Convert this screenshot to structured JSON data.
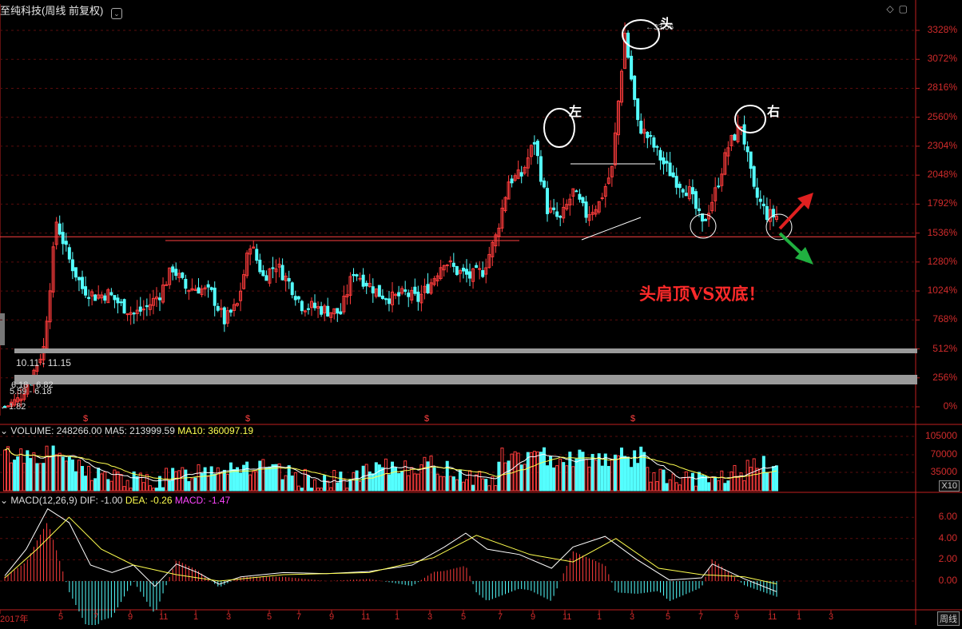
{
  "header": {
    "title": "至纯科技(周线 前复权)",
    "toolbar_icons": [
      "chevron-icon",
      "diamond-icon",
      "square-icon"
    ]
  },
  "price_axis_labels": [
    "3328%",
    "3072%",
    "2816%",
    "2560%",
    "2304%",
    "2048%",
    "1792%",
    "1536%",
    "1280%",
    "1024%",
    "768%",
    "512%",
    "256%",
    "0%"
  ],
  "annotations": {
    "head_label": "头",
    "left_shoulder_label": "左",
    "right_shoulder_label": "右",
    "caption": "头肩顶VS双底！",
    "peak_value": "33.56",
    "low_value": "1.82"
  },
  "period_bars": {
    "bar1_label": "10.11 - 11.15",
    "bar2_label_a": "6.18 - 6.82",
    "bar2_label_b": "5.59 - 6.18"
  },
  "volume": {
    "legend_label": "VOLUME: 248266.00",
    "ma5_label": "MA5: 213999.59",
    "ma10_label": "MA10: 360097.19",
    "axis_labels": [
      "105000",
      "70000",
      "35000"
    ],
    "unit": "X10"
  },
  "macd": {
    "legend_label": "MACD(12,26,9)",
    "dif_label": "DIF: -1.00",
    "dea_label": "DEA: -0.26",
    "macd_label": "MACD: -1.47",
    "axis_labels": [
      "6.00",
      "4.00",
      "2.00",
      "0.00"
    ]
  },
  "x_axis_labels": [
    "2017年",
    "5",
    "7",
    "9",
    "11",
    "1",
    "3",
    "5",
    "7",
    "9",
    "11",
    "1",
    "3",
    "5",
    "7",
    "9",
    "11",
    "1",
    "3",
    "5",
    "7",
    "9",
    "11",
    "1",
    "3"
  ],
  "corner_label": "周线",
  "colors": {
    "up": "#ff3c3c",
    "down": "#54ffff",
    "ma5": "#ffffff",
    "ma10": "#ffff4f",
    "axis": "#c02020",
    "arrow_up": "#e02020",
    "arrow_down": "#20b040"
  },
  "chart_data": {
    "type": "candlestick",
    "title": "至纯科技(周线 前复权)",
    "ylabel": "",
    "ylim": [
      0,
      3328
    ],
    "y_unit": "%",
    "close_path_pct": [
      [
        0,
        0
      ],
      [
        2,
        60
      ],
      [
        4,
        250
      ],
      [
        6,
        520
      ],
      [
        8,
        1640
      ],
      [
        10,
        1300
      ],
      [
        12,
        1050
      ],
      [
        14,
        980
      ],
      [
        16,
        1000
      ],
      [
        18,
        900
      ],
      [
        20,
        820
      ],
      [
        22,
        880
      ],
      [
        24,
        1000
      ],
      [
        26,
        1230
      ],
      [
        28,
        1050
      ],
      [
        30,
        1050
      ],
      [
        32,
        1000
      ],
      [
        34,
        760
      ],
      [
        36,
        900
      ],
      [
        38,
        1450
      ],
      [
        40,
        1150
      ],
      [
        42,
        1260
      ],
      [
        44,
        1100
      ],
      [
        46,
        900
      ],
      [
        48,
        880
      ],
      [
        50,
        850
      ],
      [
        52,
        830
      ],
      [
        54,
        1200
      ],
      [
        56,
        1100
      ],
      [
        58,
        1000
      ],
      [
        60,
        960
      ],
      [
        62,
        1000
      ],
      [
        64,
        950
      ],
      [
        66,
        1100
      ],
      [
        68,
        1300
      ],
      [
        70,
        1200
      ],
      [
        72,
        1150
      ],
      [
        74,
        1200
      ],
      [
        76,
        1500
      ],
      [
        78,
        2000
      ],
      [
        80,
        2050
      ],
      [
        82,
        2350
      ],
      [
        84,
        1750
      ],
      [
        86,
        1650
      ],
      [
        88,
        1900
      ],
      [
        90,
        1700
      ],
      [
        92,
        1800
      ],
      [
        94,
        2100
      ],
      [
        96,
        3300
      ],
      [
        98,
        2500
      ],
      [
        100,
        2350
      ],
      [
        102,
        2150
      ],
      [
        104,
        2000
      ],
      [
        106,
        1900
      ],
      [
        108,
        1600
      ],
      [
        110,
        1900
      ],
      [
        112,
        2300
      ],
      [
        114,
        2500
      ],
      [
        116,
        1900
      ],
      [
        118,
        1700
      ],
      [
        120,
        1680
      ]
    ],
    "resistance_pct": 1560
  }
}
